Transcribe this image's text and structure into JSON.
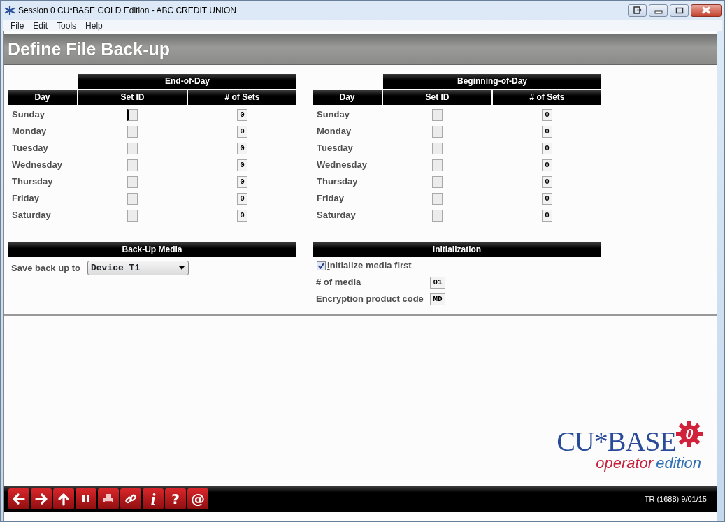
{
  "window": {
    "title": "Session 0 CU*BASE GOLD Edition - ABC CREDIT UNION"
  },
  "menu": [
    "File",
    "Edit",
    "Tools",
    "Help"
  ],
  "page_title": "Define File Back-up",
  "schedules": [
    {
      "group": "End-of-Day",
      "columns": [
        "Day",
        "Set ID",
        "# of Sets"
      ],
      "rows": [
        {
          "day": "Sunday",
          "set_id_focused": true,
          "sets": "0"
        },
        {
          "day": "Monday",
          "set_id_focused": false,
          "sets": "0"
        },
        {
          "day": "Tuesday",
          "set_id_focused": false,
          "sets": "0"
        },
        {
          "day": "Wednesday",
          "set_id_focused": false,
          "sets": "0"
        },
        {
          "day": "Thursday",
          "set_id_focused": false,
          "sets": "0"
        },
        {
          "day": "Friday",
          "set_id_focused": false,
          "sets": "0"
        },
        {
          "day": "Saturday",
          "set_id_focused": false,
          "sets": "0"
        }
      ]
    },
    {
      "group": "Beginning-of-Day",
      "columns": [
        "Day",
        "Set ID",
        "# of Sets"
      ],
      "rows": [
        {
          "day": "Sunday",
          "set_id_focused": false,
          "sets": "0"
        },
        {
          "day": "Monday",
          "set_id_focused": false,
          "sets": "0"
        },
        {
          "day": "Tuesday",
          "set_id_focused": false,
          "sets": "0"
        },
        {
          "day": "Wednesday",
          "set_id_focused": false,
          "sets": "0"
        },
        {
          "day": "Thursday",
          "set_id_focused": false,
          "sets": "0"
        },
        {
          "day": "Friday",
          "set_id_focused": false,
          "sets": "0"
        },
        {
          "day": "Saturday",
          "set_id_focused": false,
          "sets": "0"
        }
      ]
    }
  ],
  "backup_media": {
    "title": "Back-Up Media",
    "label": "Save back up to",
    "value": "Device T1"
  },
  "initialization": {
    "title": "Initialization",
    "checkbox": {
      "label": "Initialize media first",
      "checked": true
    },
    "fields": [
      {
        "label": "# of media",
        "value": "01"
      },
      {
        "label": "Encryption product code",
        "value": "MD"
      }
    ]
  },
  "logo": {
    "name": "CU*BASE",
    "badge": "0",
    "tagline_red": "operator",
    "tagline_blue": "edition"
  },
  "toolbar": [
    {
      "kind": "back"
    },
    {
      "kind": "forward"
    },
    {
      "kind": "up"
    },
    {
      "kind": "pause"
    },
    {
      "kind": "print"
    },
    {
      "kind": "link"
    },
    {
      "kind": "text",
      "label": "i"
    },
    {
      "kind": "text",
      "label": "?"
    },
    {
      "kind": "text",
      "label": "@"
    }
  ],
  "status": "TR (1688) 9/01/15"
}
